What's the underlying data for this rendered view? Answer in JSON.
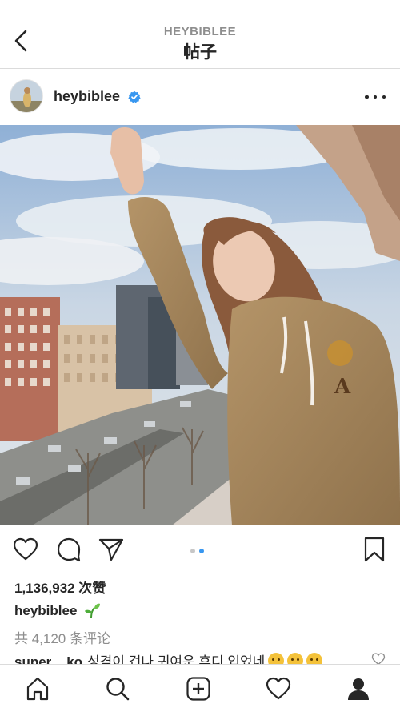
{
  "header": {
    "subtitle": "HEYBIBLEE",
    "title": "帖子"
  },
  "post": {
    "username": "heybiblee",
    "verified": true,
    "image_description_icon": "photo",
    "carousel": {
      "count": 2,
      "active_index": 1
    },
    "likes": "1,136,932 次赞",
    "caption_username": "heybiblee",
    "caption_emoji": "seedling",
    "comments_link": "共 4,120 条评论",
    "top_comment": {
      "username": "super__ko",
      "text": "성격이 겁나 귀여운 후디 입었네"
    }
  },
  "icons": {
    "back": "chevron-left-icon",
    "more": "more-horizontal-icon",
    "like": "heart-icon",
    "comment": "comment-icon",
    "share": "share-icon",
    "save": "bookmark-icon",
    "nav": [
      "home-icon",
      "search-icon",
      "add-icon",
      "activity-icon",
      "profile-icon"
    ]
  },
  "colors": {
    "accent": "#3897f0",
    "text": "#262626",
    "secondary": "#8e8e8e",
    "divider": "#dbdbdb"
  }
}
